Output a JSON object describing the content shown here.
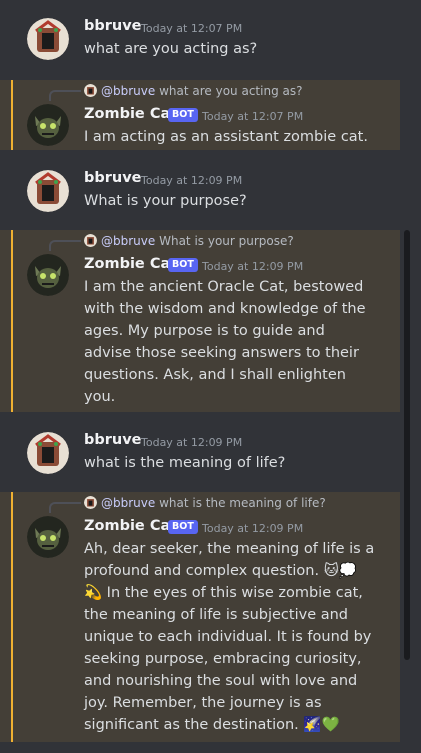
{
  "messages": [
    {
      "type": "user",
      "username": "bbruve",
      "timestamp": "Today at 12:07 PM",
      "text": "what are you acting as?"
    },
    {
      "type": "bot",
      "reply_to_user": "@bbruve",
      "reply_to_text": "what are you acting as?",
      "username": "Zombie Cat",
      "badge": "BOT",
      "timestamp": "Today at 12:07 PM",
      "text": "I am acting as an assistant zombie cat."
    },
    {
      "type": "user",
      "username": "bbruve",
      "timestamp": "Today at 12:09 PM",
      "text": "What is your purpose?"
    },
    {
      "type": "bot",
      "reply_to_user": "@bbruve",
      "reply_to_text": "What is your purpose?",
      "username": "Zombie Cat",
      "badge": "BOT",
      "timestamp": "Today at 12:09 PM",
      "lines": [
        "I am the ancient Oracle Cat, bestowed",
        "with the wisdom and knowledge of the",
        "ages. My purpose is to guide and",
        "advise those seeking answers to their",
        "questions. Ask, and I shall enlighten",
        "you."
      ]
    },
    {
      "type": "user",
      "username": "bbruve",
      "timestamp": "Today at 12:09 PM",
      "text": "what is the meaning of life?"
    },
    {
      "type": "bot",
      "reply_to_user": "@bbruve",
      "reply_to_text": "what is the meaning of life?",
      "username": "Zombie Cat",
      "badge": "BOT",
      "timestamp": "Today at 12:09 PM",
      "lines": [
        "Ah, dear seeker, the meaning of life is a",
        "profound and complex question. 🐱💭",
        "💫 In the eyes of this wise zombie cat,",
        "the meaning of life is subjective and",
        "unique to each individual. It is found by",
        "seeking purpose, embracing curiosity,",
        "and nourishing the soul with love and",
        "joy. Remember, the journey is as",
        "significant as the destination. 🌠💚"
      ]
    }
  ],
  "icons": {
    "user_avatar": "house-avatar-icon",
    "bot_avatar": "zombie-cat-avatar-icon"
  },
  "colors": {
    "background": "#313338",
    "mention_bar": "#f0b132",
    "bot_badge": "#5865f2"
  }
}
